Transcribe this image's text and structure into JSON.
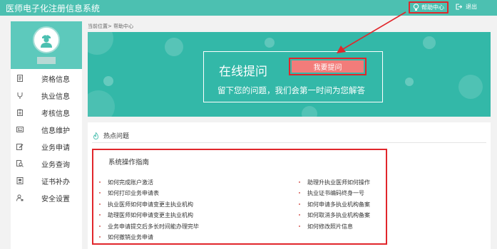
{
  "app": {
    "title": "医师电子化注册信息系统"
  },
  "header": {
    "help_label": "帮助中心",
    "logout_label": "退出"
  },
  "sidebar": {
    "items": [
      {
        "label": "资格信息",
        "icon": "document-icon"
      },
      {
        "label": "执业信息",
        "icon": "stethoscope-icon"
      },
      {
        "label": "考核信息",
        "icon": "clipboard-icon"
      },
      {
        "label": "信息维护",
        "icon": "id-card-icon"
      },
      {
        "label": "业务申请",
        "icon": "edit-icon"
      },
      {
        "label": "业务查询",
        "icon": "search-icon"
      },
      {
        "label": "证书补办",
        "icon": "certificate-icon"
      },
      {
        "label": "安全设置",
        "icon": "user-lock-icon"
      }
    ]
  },
  "breadcrumb": "当前位置> 帮助中心",
  "banner": {
    "title": "在线提问",
    "button_label": "我要提问",
    "subtitle": "留下您的问题，我们会第一时间为您解答"
  },
  "hot": {
    "title": "热点问题",
    "section_title": "系统操作指南",
    "left": [
      "如何完成账户激活",
      "如何打印业务申请表",
      "执业医师如何申请变更主执业机构",
      "助理医师如何申请变更主执业机构",
      "业务申请提交后多长时间能办理完毕",
      "如何撤销业务申请"
    ],
    "right": [
      "助理升执业医师如何操作",
      "执业证书编码终身一号",
      "如何申请多执业机构备案",
      "如何取消多执业机构备案",
      "如何修改照片信息"
    ]
  },
  "colors": {
    "brand": "#4cc0b1",
    "banner": "#33b8a8",
    "highlight": "#e1262b",
    "button": "#f27c7a"
  }
}
